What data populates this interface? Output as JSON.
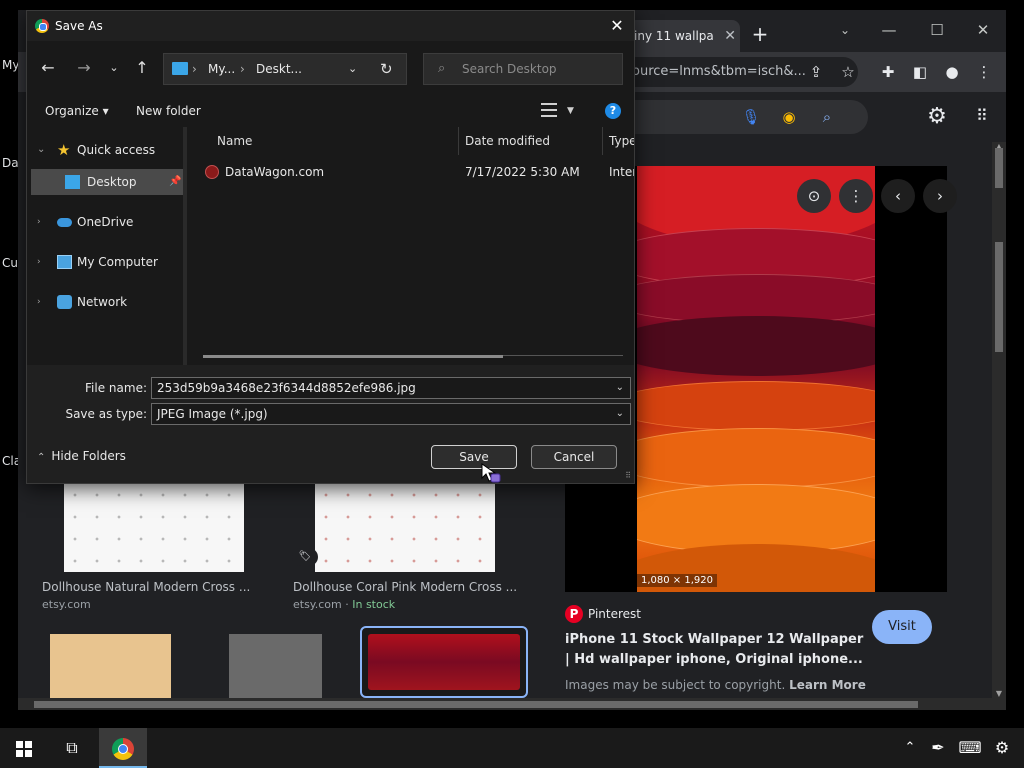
{
  "browser": {
    "tab_title": "iny 11 wallpa",
    "new_tab_glyph": "+",
    "url": "ource=lnms&tbm=isch&...",
    "edge_texts": [
      "My",
      "Da",
      "Cu",
      "Cla"
    ]
  },
  "results": [
    {
      "title": "Dollhouse Natural Modern Cross ...",
      "source": "etsy.com",
      "stock": ""
    },
    {
      "title": "Dollhouse Coral Pink Modern Cross ...",
      "source": "etsy.com · ",
      "stock": "In stock"
    }
  ],
  "preview": {
    "dimensions": "1,080 × 1,920",
    "source_name": "Pinterest",
    "title": "iPhone 11 Stock Wallpaper 12 Wallpaper | Hd wallpaper iphone, Original iphone...",
    "copyright": "Images may be subject to copyright.",
    "learn_more": "Learn More",
    "visit_label": "Visit"
  },
  "dialog": {
    "title": "Save As",
    "breadcrumb": [
      "My...",
      "Deskt..."
    ],
    "search_placeholder": "Search Desktop",
    "organize_label": "Organize ▾",
    "new_folder_label": "New folder",
    "nav_items": [
      {
        "label": "Quick access",
        "icon": "star-icon",
        "selected": false
      },
      {
        "label": "Desktop",
        "icon": "desktop-folder-icon",
        "selected": true
      },
      {
        "label": "OneDrive",
        "icon": "cloud-icon",
        "selected": false
      },
      {
        "label": "My Computer",
        "icon": "computer-icon",
        "selected": false
      },
      {
        "label": "Network",
        "icon": "network-icon",
        "selected": false
      }
    ],
    "columns": [
      "Name",
      "Date modified",
      "Type"
    ],
    "files": [
      {
        "name": "DataWagon.com",
        "date": "7/17/2022 5:30 AM",
        "type": "Intern"
      }
    ],
    "file_name_label": "File name:",
    "file_name_value": "253d59b9a3468e23f6344d8852efe986.jpg",
    "save_type_label": "Save as type:",
    "save_type_value": "JPEG Image (*.jpg)",
    "hide_folders_label": "Hide Folders",
    "save_label": "Save",
    "cancel_label": "Cancel"
  },
  "colors": {
    "accent": "#8ab4f8",
    "dialog_bg": "#191919",
    "pinterest": "#e60023",
    "in_stock": "#81c995"
  }
}
